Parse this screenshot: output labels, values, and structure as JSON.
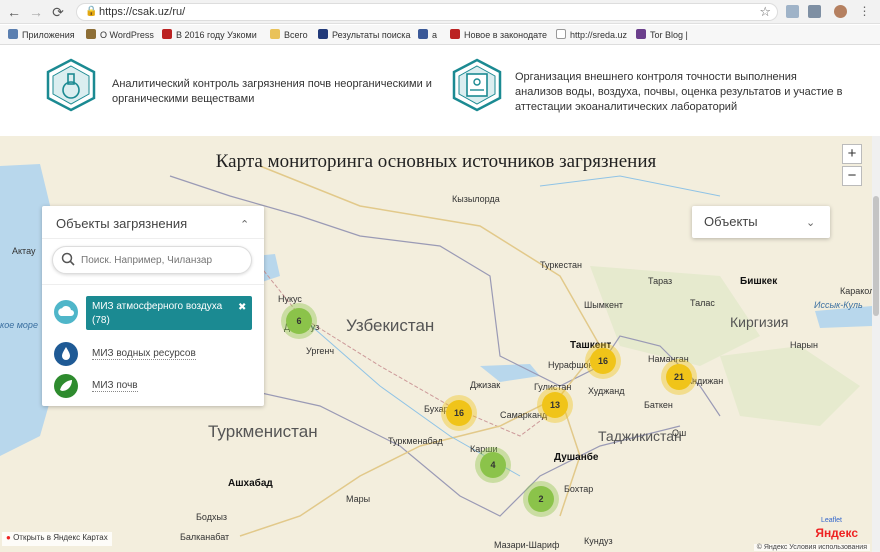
{
  "browser": {
    "url": "https://csak.uz/ru/",
    "back_icon": "←",
    "forward_icon": "→",
    "reload_icon": "⟳",
    "bookmarks": [
      "Приложения",
      "О WordPress",
      "В 2016 году Узкоми",
      "Всего",
      "Результаты поиска",
      "а",
      "Новое в законодате",
      "http://sreda.uz",
      "Tor Blog |"
    ]
  },
  "header": {
    "service_1": "Аналитический контроль загрязнения почв неорганическими и органическими веществами",
    "service_2": "Организация внешнего контроля точности выполнения анализов воды, воздуха, почвы, оценка результатов и участие в аттестации экоаналитических лабораторий"
  },
  "map": {
    "title": "Карта мониторинга основных источников загрязнения",
    "zoom_in": "+",
    "zoom_out": "−",
    "pollution_panel": {
      "title": "Объекты загрязнения",
      "search_placeholder": "Поиск. Например, Чиланзар",
      "categories": [
        {
          "label": "МИЗ атмосферного воздуха (78)",
          "color": "#4fb6c9",
          "active": true,
          "icon": "cloud-icon"
        },
        {
          "label": "МИЗ водных ресурсов",
          "color": "#1f5a95",
          "active": false,
          "icon": "water-drop-icon"
        },
        {
          "label": "МИЗ почв",
          "color": "#2e8b2e",
          "active": false,
          "icon": "leaf-icon"
        }
      ]
    },
    "objects_panel": {
      "title": "Объекты"
    },
    "countries": [
      "Узбекистан",
      "Туркменистан",
      "Таджикистан",
      "Киргизия"
    ],
    "cities": [
      "Кызылорда",
      "Туркестан",
      "Шымкент",
      "Тараз",
      "Бишкек",
      "Талас",
      "Ташкент",
      "Нурафшон",
      "Гулистан",
      "Худжанд",
      "Наманган",
      "Баткен",
      "Самарканд",
      "Бухара",
      "Туркменабад",
      "Карши",
      "Душанбе",
      "Ашхабад",
      "Мары",
      "Бохтар",
      "Нукус",
      "Дашогуз",
      "Ургенч",
      "Актау",
      "Джизак",
      "Кундуз",
      "Мазари-Шариф",
      "Бодхыз",
      "Балканабат",
      "Иссык-Куль",
      "Нарын",
      "Ош",
      "Андижан",
      "Каракол"
    ],
    "seas": [
      "кое море"
    ],
    "clusters": [
      {
        "value": "6",
        "color": "#8bc34a"
      },
      {
        "value": "16",
        "color": "#f0c419"
      },
      {
        "value": "21",
        "color": "#f0c419"
      },
      {
        "value": "13",
        "color": "#f0c419"
      },
      {
        "value": "16",
        "color": "#f0c419"
      },
      {
        "value": "4",
        "color": "#8bc34a"
      },
      {
        "value": "2",
        "color": "#8bc34a"
      }
    ],
    "open_link": "Открыть в Яндекс Картах",
    "logo": "Яндекс",
    "leaflet": "Leaflet",
    "copyright": "© Яндекс  Условия использования"
  }
}
